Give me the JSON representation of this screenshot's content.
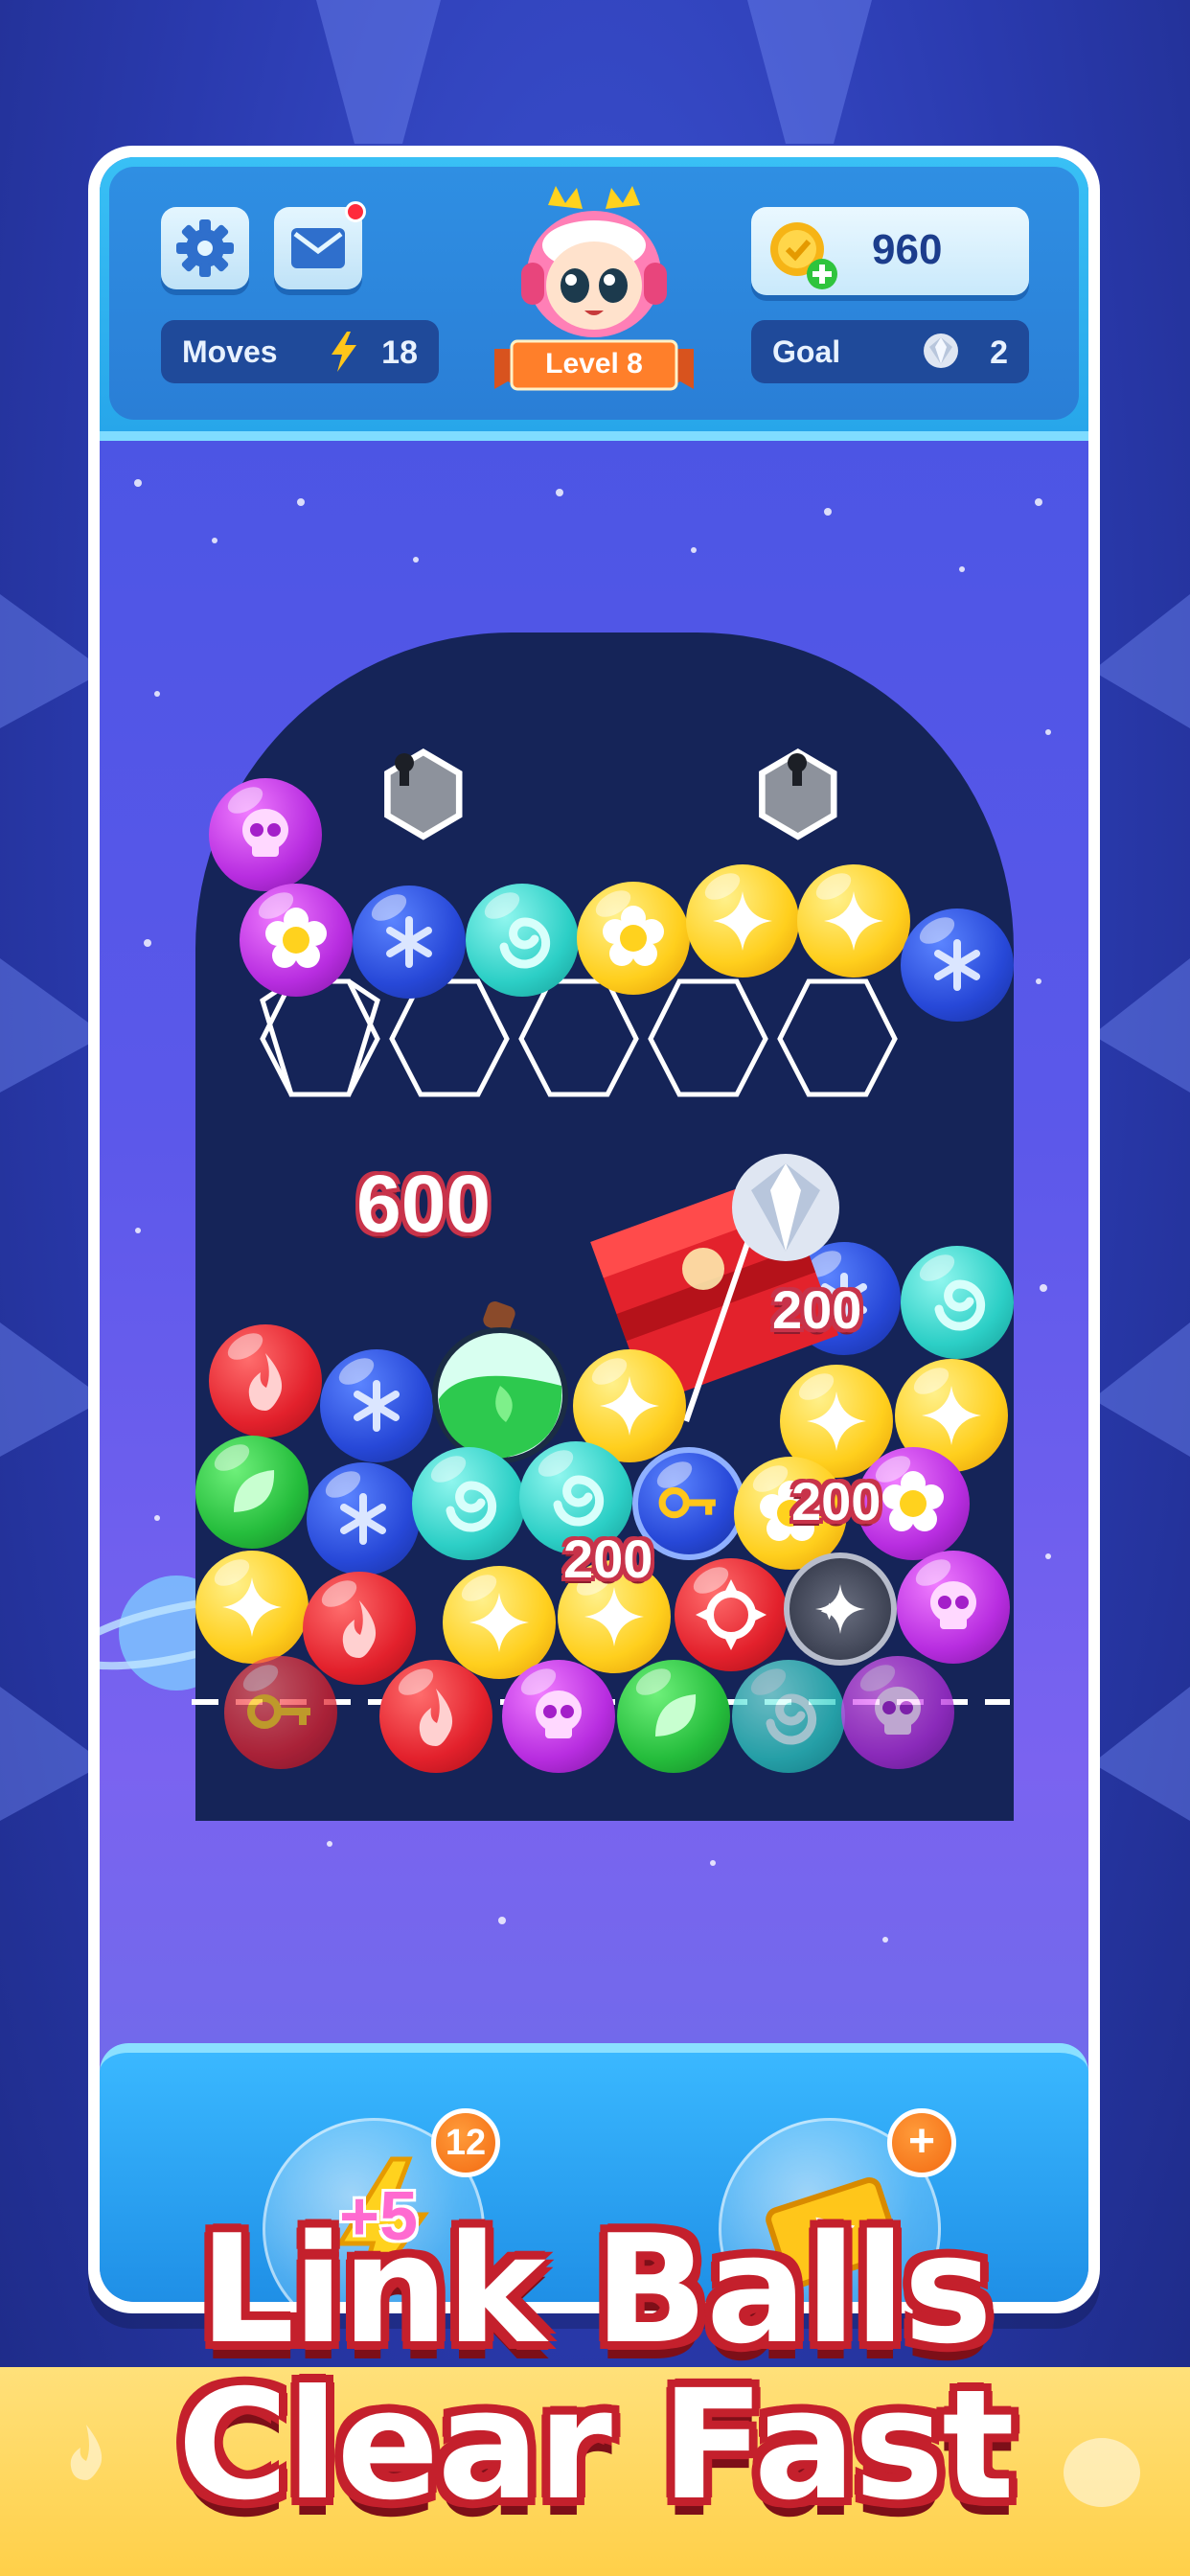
{
  "header": {
    "moves_label": "Moves",
    "moves_value": "18",
    "coins_value": "960",
    "level_label": "Level 8",
    "goal_label": "Goal",
    "goal_value": "2"
  },
  "board": {
    "score_popups": [
      "600",
      "200",
      "200",
      "200"
    ]
  },
  "boosters": {
    "lightning": {
      "count": "12",
      "bonus": "+5"
    },
    "video_ticket": {
      "badge": "+"
    }
  },
  "slogan": {
    "line1": "Link Balls",
    "line2": "Clear Fast"
  },
  "colors": {
    "accent_blue": "#27a6ea",
    "board": "#152458",
    "slogan_outline": "#c4202c",
    "band": "#ffd049"
  },
  "icons": [
    "gear-icon",
    "mail-icon",
    "lightning-icon",
    "coin-plus-icon",
    "diamond-icon",
    "lock-icon",
    "key-icon",
    "skull-icon",
    "flower-icon",
    "snowflake-icon",
    "swirl-icon",
    "star-icon",
    "fire-icon",
    "leaf-icon"
  ]
}
